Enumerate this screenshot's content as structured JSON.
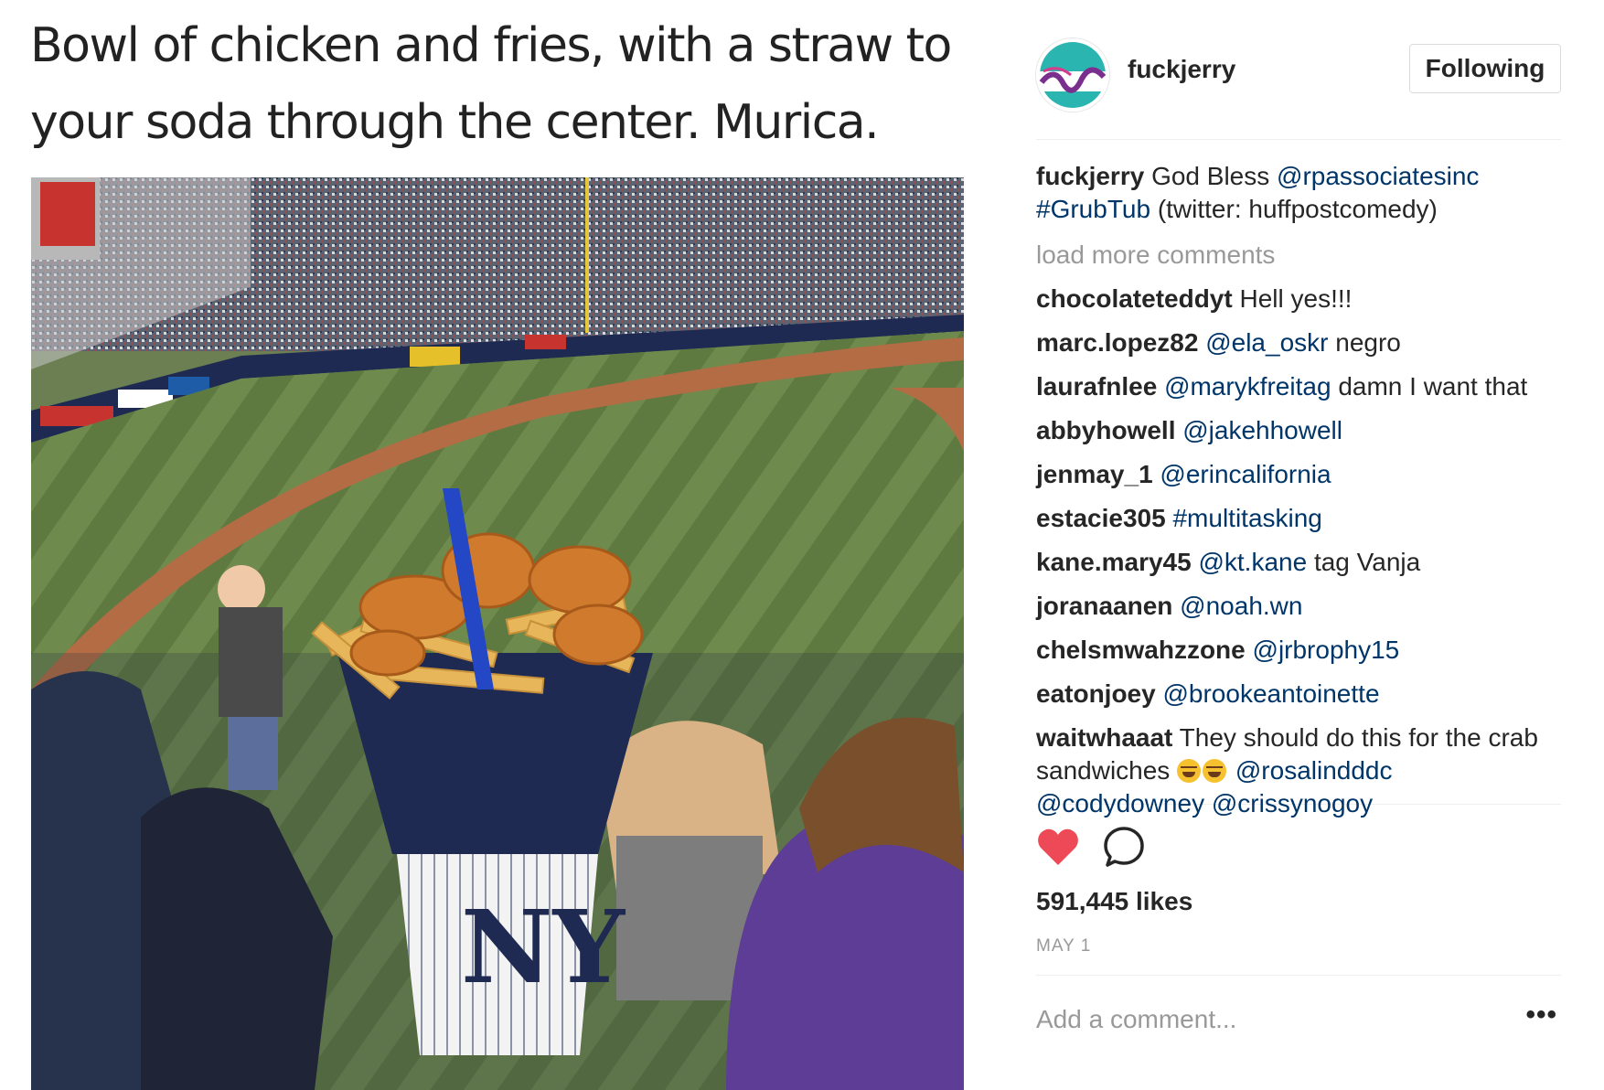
{
  "headline": {
    "line1": "Bowl of chicken and fries, with a straw to",
    "line2": "your soda through the center. Murica."
  },
  "post": {
    "username": "fuckjerry",
    "follow_label": "Following",
    "caption": {
      "user": "fuckjerry",
      "text1": "God Bless",
      "mention": "@rpassociatesinc",
      "hashtag": "#GrubTub",
      "text2": "(twitter: huffpostcomedy)"
    },
    "load_more": "load more comments",
    "comments": [
      {
        "user": "chocolateteddyt",
        "link": "",
        "text": "Hell yes!!!"
      },
      {
        "user": "marc.lopez82",
        "link": "@ela_oskr",
        "text": "negro"
      },
      {
        "user": "laurafnlee",
        "link": "@marykfreitag",
        "text": "damn I want that"
      },
      {
        "user": "abbyhowell",
        "link": "@jakehhowell",
        "text": ""
      },
      {
        "user": "jenmay_1",
        "link": "@erincalifornia",
        "text": ""
      },
      {
        "user": "estacie305",
        "link": "#multitasking",
        "text": ""
      },
      {
        "user": "kane.mary45",
        "link": "@kt.kane",
        "text": "tag Vanja"
      },
      {
        "user": "joranaanen",
        "link": "@noah.wn",
        "text": ""
      },
      {
        "user": "chelsmwahzzone",
        "link": "@jrbrophy15",
        "text": ""
      },
      {
        "user": "eatonjoey",
        "link": "@brookeantoinette",
        "text": ""
      }
    ],
    "last_comment": {
      "user": "waitwhaaat",
      "text1": "They should do this for the",
      "text2": "crab sandwiches",
      "mention1": "@rosalindddc",
      "mention2": "@codydowney",
      "mention3": "@crissynogoy"
    },
    "liked": true,
    "likes": "591,445 likes",
    "date": "MAY 1",
    "add_comment_placeholder": "Add a comment...",
    "more_label": "•••"
  },
  "colors": {
    "link": "#003569",
    "heart": "#ed4956",
    "muted": "#999999",
    "text": "#262626"
  },
  "icons": [
    "heart-icon",
    "comment-bubble-icon",
    "more-options-icon",
    "laughing-emoji-icon"
  ]
}
